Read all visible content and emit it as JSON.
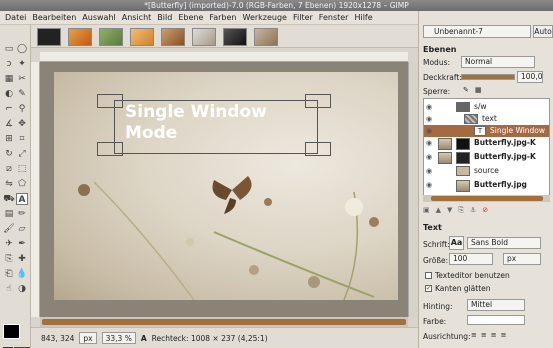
{
  "window": {
    "title": "*[Butterfly] (imported)-7.0 (RGB-Farben, 7 Ebenen) 1920x1278 – GIMP"
  },
  "menu": [
    "Datei",
    "Bearbeiten",
    "Auswahl",
    "Ansicht",
    "Bild",
    "Ebene",
    "Farben",
    "Werkzeuge",
    "Filter",
    "Fenster",
    "Hilfe"
  ],
  "canvas": {
    "text": "Single Window Mode"
  },
  "status": {
    "coords": "843, 324",
    "unit": "px",
    "zoom": "33,3 %",
    "message": "Rechteck: 1008 × 237  (4,25:1)"
  },
  "dock": {
    "image_select": "Unbenannt-7",
    "auto_button": "Auto",
    "layers_header": "Ebenen",
    "mode_label": "Modus:",
    "mode_value": "Normal",
    "opacity_label": "Deckkraft:",
    "opacity_value": "100,0",
    "lock_label": "Sperre:",
    "layers": [
      {
        "name": "s/w"
      },
      {
        "name": "text"
      },
      {
        "name": "Single Window"
      },
      {
        "name": "Butterfly.jpg-K"
      },
      {
        "name": "Butterfly.jpg-K"
      },
      {
        "name": "source"
      },
      {
        "name": "Butterfly.jpg"
      }
    ],
    "text_header": "Text",
    "font_label": "Schrift:",
    "font_value": "Sans Bold",
    "size_label": "Größe:",
    "size_value": "100",
    "size_unit": "px",
    "editor_checkbox": "Texteditor benutzen",
    "antialias_checkbox": "Kanten glätten",
    "hinting_label": "Hinting:",
    "hinting_value": "Mittel",
    "color_label": "Farbe:",
    "justify_label": "Ausrichtung:"
  },
  "colors": {
    "selection": "#a56a42",
    "accent": "#a0703e"
  }
}
